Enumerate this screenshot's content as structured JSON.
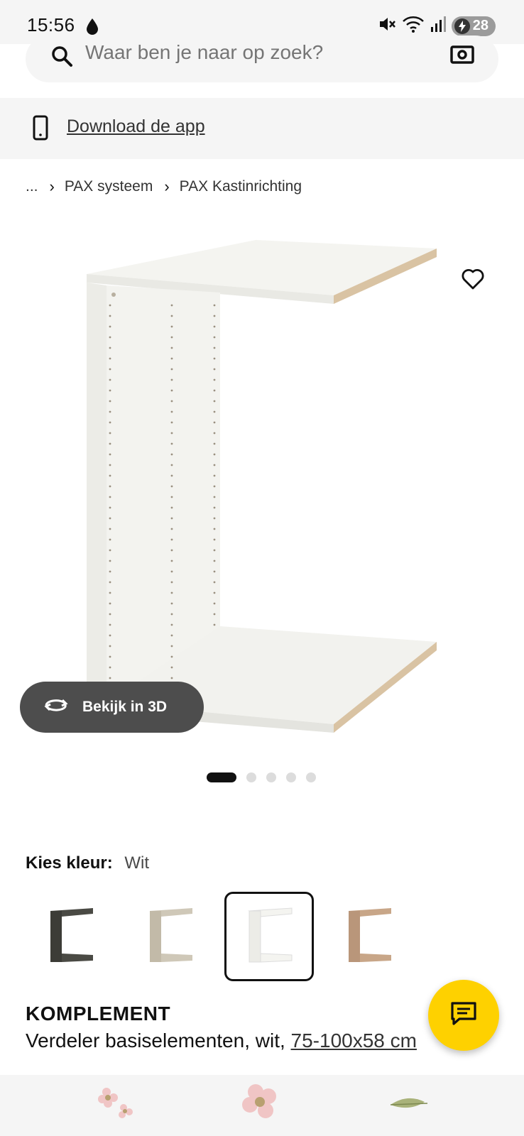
{
  "status_bar": {
    "time": "15:56",
    "battery": "28",
    "icons": [
      "water-drop-icon",
      "mute-icon",
      "wifi-icon",
      "signal-icon",
      "battery-charging-icon"
    ]
  },
  "search": {
    "placeholder": "Waar ben je naar op zoek?"
  },
  "app_banner": {
    "link_label": "Download de app"
  },
  "breadcrumb": {
    "ellipsis": "...",
    "items": [
      "PAX systeem",
      "PAX Kastinrichting"
    ]
  },
  "gallery": {
    "view_3d_label": "Bekijk in 3D",
    "dot_count": 5,
    "active_dot": 1
  },
  "color_selector": {
    "label": "Kies kleur:",
    "selected_value": "Wit",
    "swatches": [
      {
        "name": "zwartbruin",
        "color": "#4a4a44"
      },
      {
        "name": "beige",
        "color": "#cfc8b8"
      },
      {
        "name": "wit",
        "color": "#f2f2ee",
        "selected": true
      },
      {
        "name": "wit gebeitst eikeneffect",
        "color": "#c8a688"
      }
    ]
  },
  "product": {
    "name": "KOMPLEMENT",
    "description": "Verdeler basiselementen, wit, ",
    "dimensions": "75-100x58 cm"
  },
  "colors": {
    "accent_yellow": "#fed100",
    "dark_pill": "#4d4d4d",
    "surface_grey": "#f5f5f5"
  }
}
